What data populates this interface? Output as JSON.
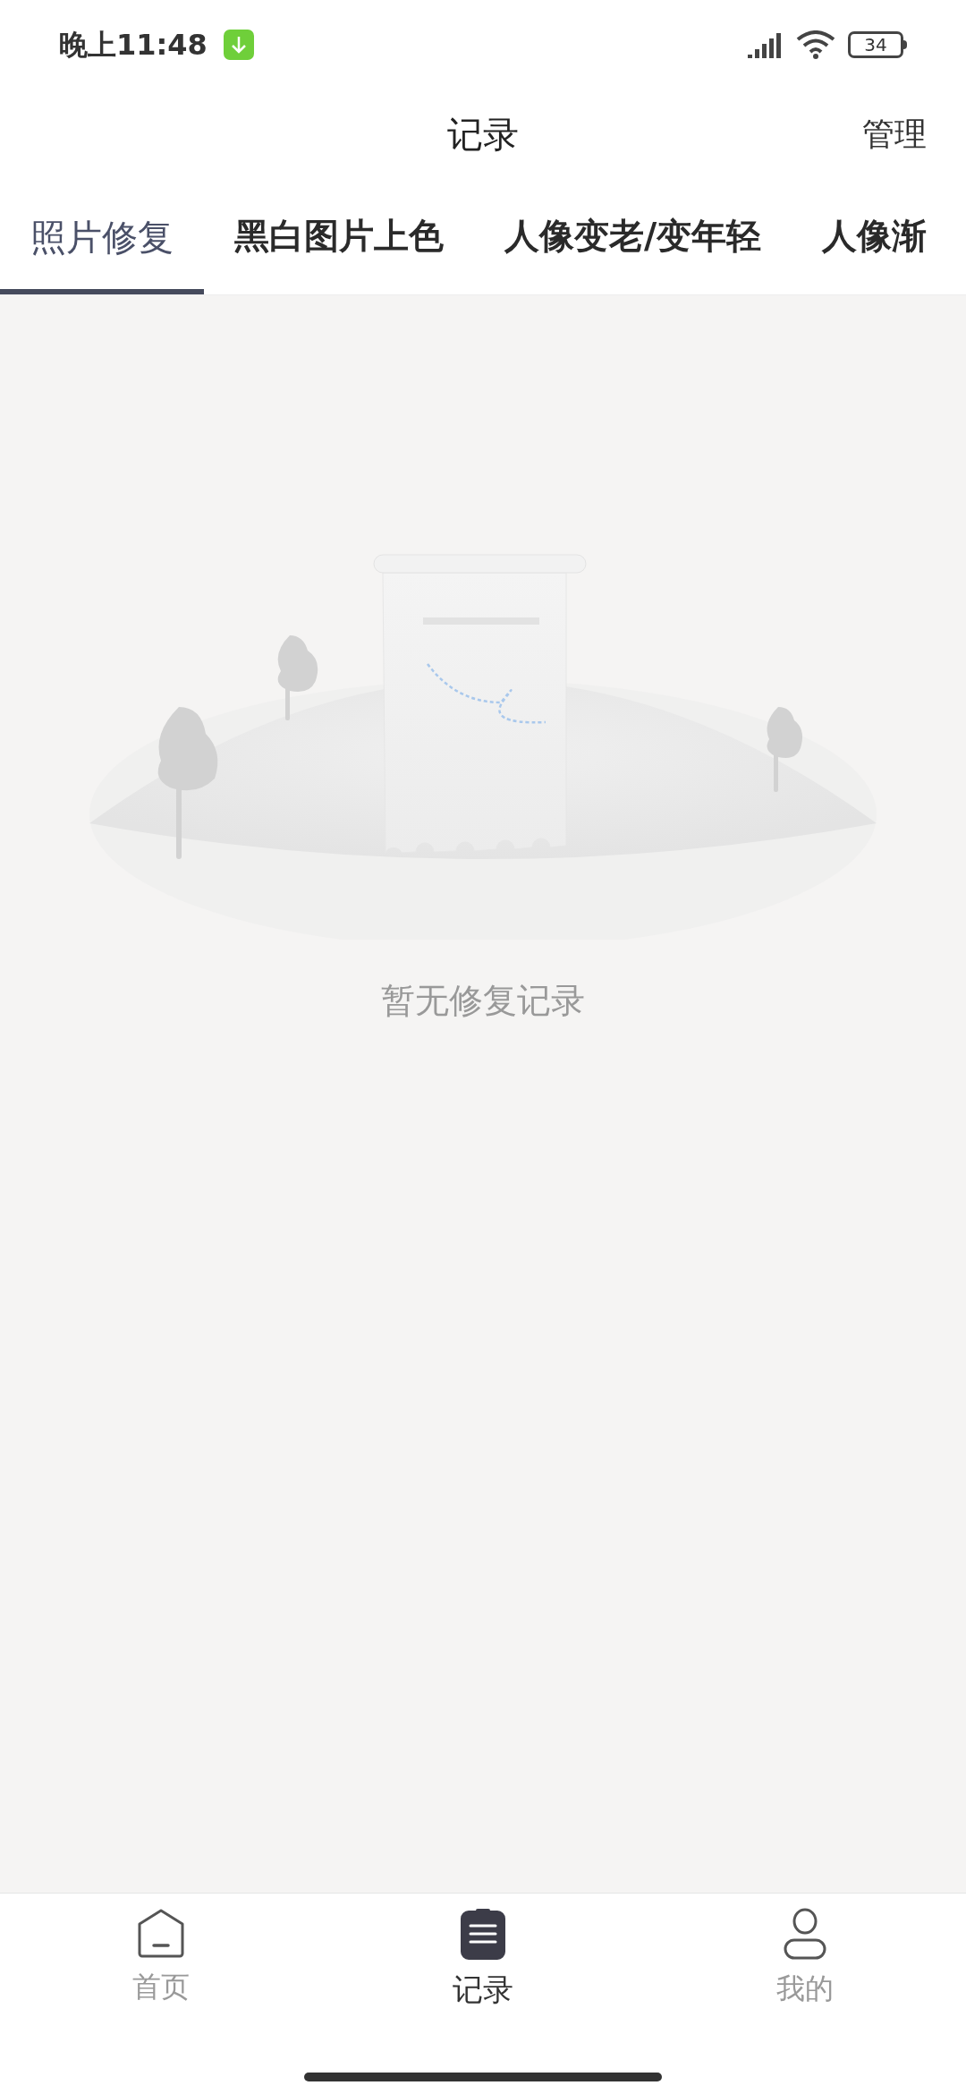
{
  "status_bar": {
    "time": "晚上11:48",
    "battery": "34"
  },
  "header": {
    "title": "记录",
    "action": "管理"
  },
  "tabs": [
    {
      "label": "照片修复",
      "selected": true
    },
    {
      "label": "黑白图片上色",
      "selected": false
    },
    {
      "label": "人像变老/变年轻",
      "selected": false
    },
    {
      "label": "人像渐",
      "selected": false
    }
  ],
  "empty_state": {
    "message": "暂无修复记录"
  },
  "bottom_nav": [
    {
      "kind": "home",
      "label": "首页",
      "selected": false
    },
    {
      "kind": "records",
      "label": "记录",
      "selected": true
    },
    {
      "kind": "profile",
      "label": "我的",
      "selected": false
    }
  ]
}
